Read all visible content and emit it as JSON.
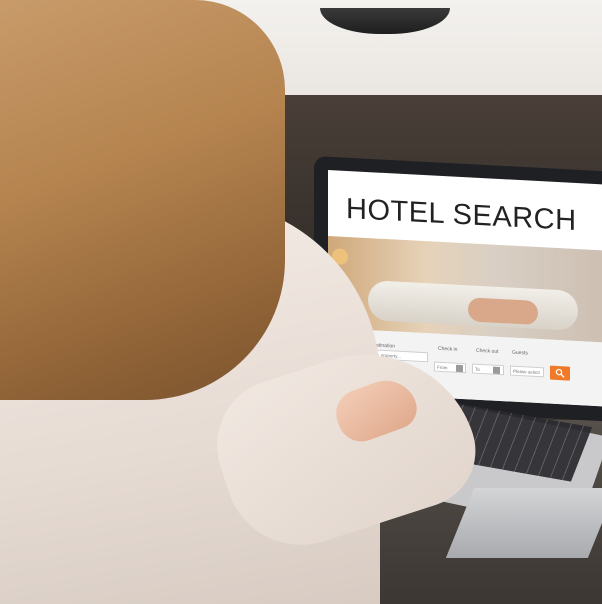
{
  "laptop_screen": {
    "title": "HOTEL SEARCH",
    "form": {
      "destination_label": "Destination",
      "destination_placeholder": "City, property...",
      "checkin_label": "Check in",
      "checkin_value": "From",
      "checkout_label": "Check out",
      "checkout_value": "To",
      "guests_label": "Guests",
      "guests_value": "Please select",
      "search_icon": "search-icon"
    },
    "accent_color": "#f07a2a"
  }
}
